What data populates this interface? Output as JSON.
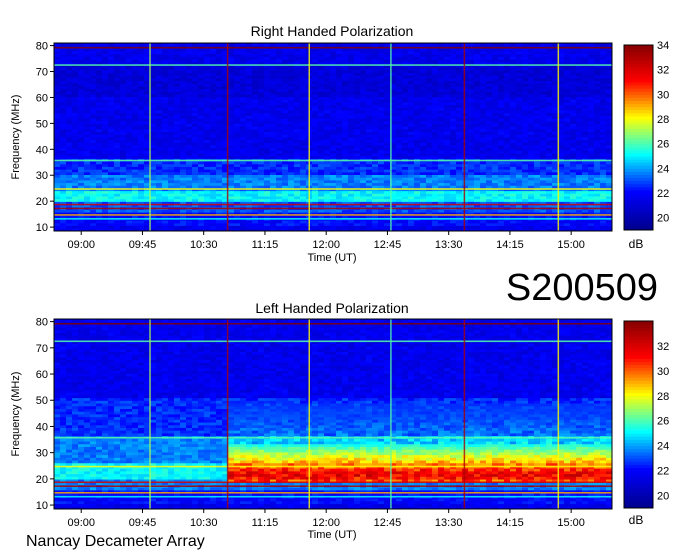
{
  "colors": {
    "colormap": [
      "#00008f",
      "#0000ff",
      "#00ffff",
      "#ffff00",
      "#ff0000",
      "#800000"
    ],
    "background": "#ffffff",
    "axis": "#000000"
  },
  "station_label": "Nancay Decameter Array",
  "event_id": "S200509",
  "chart_data": [
    {
      "type": "heatmap",
      "title": "Right Handed Polarization",
      "xlabel": "Time (UT)",
      "ylabel": "Frequency (MHz)",
      "x_ticks": [
        "09:00",
        "09:45",
        "10:30",
        "11:15",
        "12:00",
        "12:45",
        "13:30",
        "14:15",
        "15:00"
      ],
      "y_ticks": [
        10,
        20,
        30,
        40,
        50,
        60,
        70,
        80
      ],
      "ylim": [
        10,
        80
      ],
      "colorbar": {
        "label": "dB",
        "ticks": [
          20,
          22,
          24,
          26,
          28,
          30,
          32,
          34
        ],
        "range": [
          19,
          34
        ]
      },
      "band_levels": [
        {
          "f": [
            10,
            15
          ],
          "db": 22
        },
        {
          "f": [
            15,
            19
          ],
          "db": 23
        },
        {
          "f": [
            19,
            24
          ],
          "db": 25
        },
        {
          "f": [
            24,
            30
          ],
          "db": 23.5
        },
        {
          "f": [
            30,
            36
          ],
          "db": 22.5
        },
        {
          "f": [
            36,
            60
          ],
          "db": 21.5
        },
        {
          "f": [
            60,
            72
          ],
          "db": 21
        },
        {
          "f": [
            72,
            80
          ],
          "db": 21.5
        }
      ]
    },
    {
      "type": "heatmap",
      "title": "Left Handed Polarization",
      "xlabel": "Time (UT)",
      "ylabel": "Frequency (MHz)",
      "x_ticks": [
        "09:00",
        "09:45",
        "10:30",
        "11:15",
        "12:00",
        "12:45",
        "13:30",
        "14:15",
        "15:00"
      ],
      "y_ticks": [
        10,
        20,
        30,
        40,
        50,
        60,
        70,
        80
      ],
      "ylim": [
        10,
        80
      ],
      "colorbar": {
        "label": "dB",
        "ticks": [
          20,
          22,
          24,
          26,
          28,
          30,
          32
        ],
        "range": [
          19,
          34
        ]
      },
      "band_levels": [
        {
          "f": [
            10,
            15
          ],
          "db": 22
        },
        {
          "f": [
            15,
            19
          ],
          "db": 23.5
        },
        {
          "f": [
            19,
            26
          ],
          "db": 25
        },
        {
          "f": [
            26,
            36
          ],
          "db": 23.5
        },
        {
          "f": [
            36,
            50
          ],
          "db": 22.5
        },
        {
          "f": [
            50,
            80
          ],
          "db": 21.5
        }
      ],
      "emission": {
        "t_start": "10:50",
        "t_end": "15:30",
        "f_low": 18,
        "f_high": 33,
        "db_peak": 32
      }
    }
  ]
}
